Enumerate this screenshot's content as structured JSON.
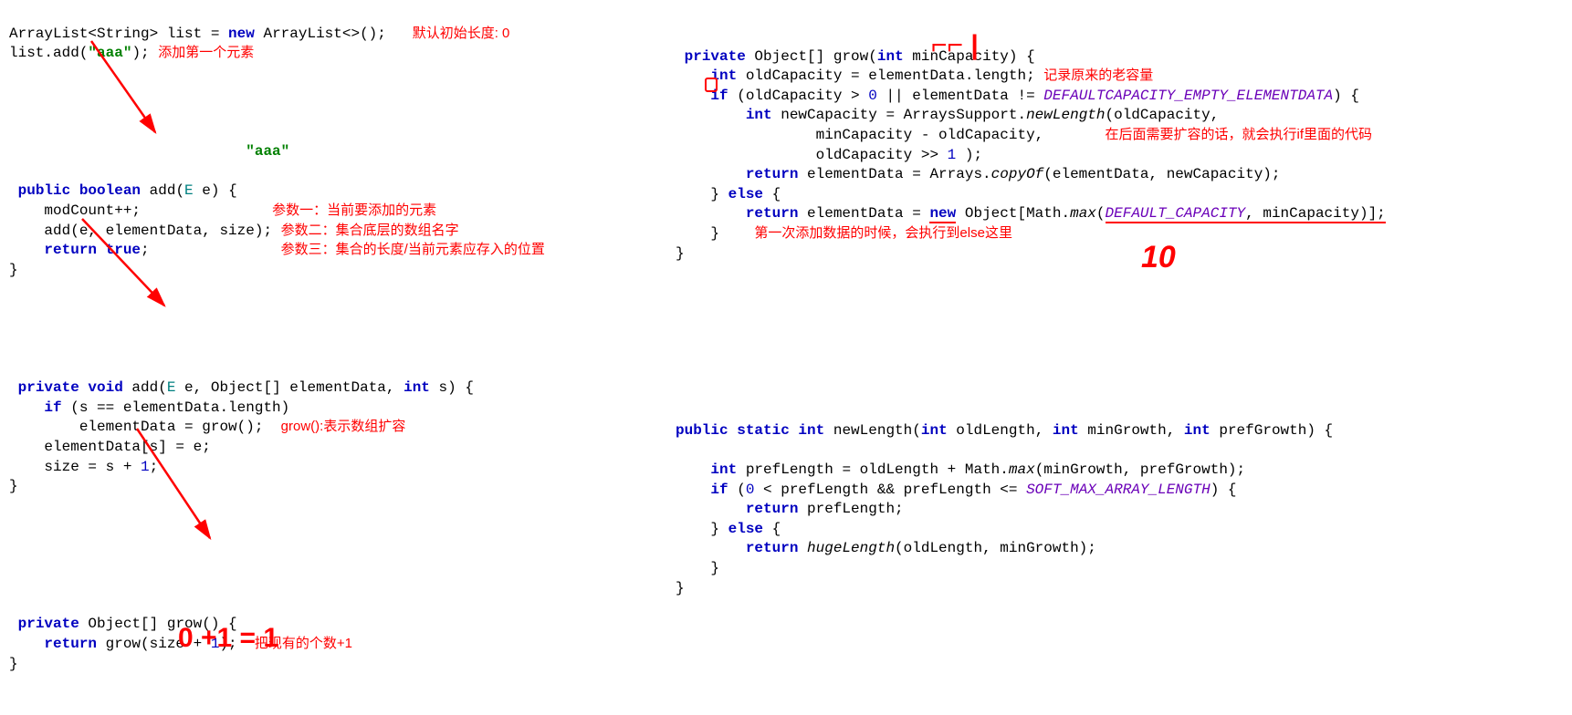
{
  "left": {
    "l1a": "ArrayList<String> list = ",
    "l1b": "new",
    "l1c": " ArrayList<>();",
    "l1ann": "默认初始长度: 0",
    "l2a": "list.add(",
    "l2b": "\"aaa\"",
    "l2c": ");",
    "l2ann": "添加第一个元素",
    "aaaLabel": "\"aaa\"",
    "add1_sig_a": "public boolean",
    "add1_sig_b": " add(",
    "add1_sig_c": "E",
    "add1_sig_d": " e) {",
    "add1_l1a": "    modCount++;",
    "add1_ann1": "参数一：当前要添加的元素",
    "add1_l2a": "    add(e, elementData, size);",
    "add1_ann2": "参数二：集合底层的数组名字",
    "add1_l3a": "    ",
    "add1_l3b": "return true",
    "add1_l3c": ";",
    "add1_ann3": "参数三：集合的长度/当前元素应存入的位置",
    "add1_l4": "}",
    "add2_sig_a": "private void",
    "add2_sig_b": " add(",
    "add2_sig_c": "E",
    "add2_sig_d": " e, Object[] elementData, ",
    "add2_sig_e": "int",
    "add2_sig_f": " s) {",
    "add2_l1a": "    ",
    "add2_l1b": "if",
    "add2_l1c": " (s == elementData.length)",
    "add2_l2a": "        elementData = grow();",
    "add2_ann1": "grow():表示数组扩容",
    "add2_l3": "    elementData[s] = e;",
    "add2_l4a": "    size = s + ",
    "add2_l4b": "1",
    "add2_l4c": ";",
    "add2_l5": "}",
    "grow_sig_a": "private",
    "grow_sig_b": " Object[] grow() {",
    "grow_l1a": "    ",
    "grow_l1b": "return",
    "grow_l1c": " grow(size + ",
    "grow_l1d": "1",
    "grow_l1e": ");",
    "grow_ann": "把现有的个数+1",
    "grow_l2": "}",
    "hand1": "0 +1 = 1"
  },
  "right": {
    "grow2_sig_a": "private",
    "grow2_sig_b": " Object[] grow(",
    "grow2_sig_c": "int",
    "grow2_sig_d": " minCapacity) {",
    "grow2_l1a": "    ",
    "grow2_l1b": "int",
    "grow2_l1c": " oldCapacity = elementData.length;",
    "grow2_ann1": "记录原来的老容量",
    "grow2_l2a": "    ",
    "grow2_l2b": "if",
    "grow2_l2c": " (oldCapacity > ",
    "grow2_l2d": "0",
    "grow2_l2e": " || elementData != ",
    "grow2_l2f": "DEFAULTCAPACITY_EMPTY_ELEMENTDATA",
    "grow2_l2g": ") {",
    "grow2_l3a": "        ",
    "grow2_l3b": "int",
    "grow2_l3c": " newCapacity = ArraysSupport.",
    "grow2_l3d": "newLength",
    "grow2_l3e": "(oldCapacity,",
    "grow2_l4": "                minCapacity - oldCapacity,",
    "grow2_ann2": "在后面需要扩容的话，就会执行if里面的代码",
    "grow2_l5a": "                oldCapacity >> ",
    "grow2_l5b": "1",
    "grow2_l5c": " );",
    "grow2_l6a": "        ",
    "grow2_l6b": "return",
    "grow2_l6c": " elementData = Arrays.",
    "grow2_l6d": "copyOf",
    "grow2_l6e": "(elementData, newCapacity);",
    "grow2_l7a": "    } ",
    "grow2_l7b": "else",
    "grow2_l7c": " {",
    "grow2_l8a": "        ",
    "grow2_l8b": "return",
    "grow2_l8c": " elementData = ",
    "grow2_l8d": "new",
    "grow2_l8e": " Object[Math.",
    "grow2_l8f": "max",
    "grow2_l8g": "(",
    "grow2_l8h": "DEFAULT_CAPACITY",
    "grow2_l8i": ", minCapacity)];",
    "grow2_l9": "    }",
    "grow2_ann3": "第一次添加数据的时候，会执行到else这里",
    "grow2_l10": "}",
    "hand2": "10",
    "nl_sig_a": "public static int",
    "nl_sig_b": " newLength(",
    "nl_sig_c": "int",
    "nl_sig_d": " oldLength, ",
    "nl_sig_e": "int",
    "nl_sig_f": " minGrowth, ",
    "nl_sig_g": "int",
    "nl_sig_h": " prefGrowth) {",
    "nl_l1a": "    ",
    "nl_l1b": "int",
    "nl_l1c": " prefLength = oldLength + Math.",
    "nl_l1d": "max",
    "nl_l1e": "(minGrowth, prefGrowth);",
    "nl_l2a": "    ",
    "nl_l2b": "if",
    "nl_l2c": " (",
    "nl_l2d": "0",
    "nl_l2e": " < prefLength && prefLength <= ",
    "nl_l2f": "SOFT_MAX_ARRAY_LENGTH",
    "nl_l2g": ") {",
    "nl_l3a": "        ",
    "nl_l3b": "return",
    "nl_l3c": " prefLength;",
    "nl_l4a": "    } ",
    "nl_l4b": "else",
    "nl_l4c": " {",
    "nl_l5a": "        ",
    "nl_l5b": "return",
    "nl_l5c": " ",
    "nl_l5d": "hugeLength",
    "nl_l5e": "(oldLength, minGrowth);",
    "nl_l6": "    }",
    "nl_l7": "}"
  }
}
